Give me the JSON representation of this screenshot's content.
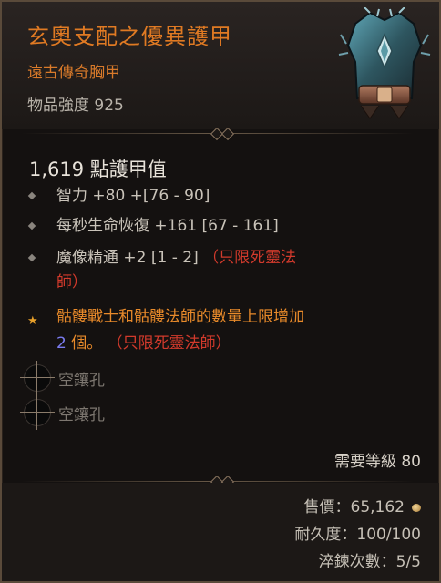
{
  "item": {
    "name": "玄奧支配之優異護甲",
    "type": "遠古傳奇胸甲",
    "power": "物品強度 925"
  },
  "stats": {
    "armor": "1,619 點護甲值",
    "affixes": [
      {
        "text": "智力 +80 +[76 - 90]"
      },
      {
        "text": "每秒生命恢復 +161 [67 - 161]"
      },
      {
        "line1": "魔像精通 +2 [1 - 2]",
        "restriction1": "（只限死靈法",
        "restriction2": "師）"
      }
    ],
    "legendary": {
      "line1": "骷髏戰士和骷髏法師的數量上限增加",
      "number": "2",
      "unit": " 個。",
      "restriction": "（只限死靈法師）"
    }
  },
  "sockets": [
    {
      "label": "空鑲孔"
    },
    {
      "label": "空鑲孔"
    }
  ],
  "requirement": "需要等級 80",
  "footer": {
    "price": "售價：65,162",
    "durability": "耐久度：100/100",
    "masterwork": "淬鍊次數：5/5"
  },
  "colors": {
    "title": "#e07a23",
    "restriction": "#d23a2c",
    "number": "#7b7cf0"
  },
  "icons": {
    "item_art": "chest-armor-icon",
    "price": "gold-coin-icon"
  }
}
